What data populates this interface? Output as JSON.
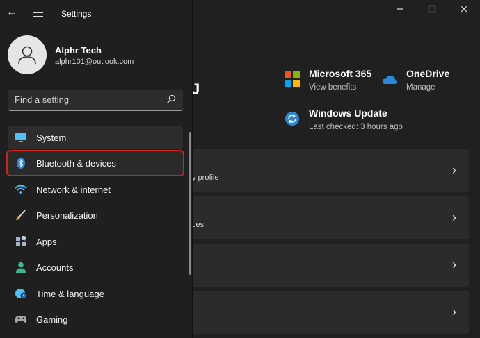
{
  "app": {
    "title": "Settings"
  },
  "user": {
    "name": "Alphr Tech",
    "email": "alphr101@outlook.com"
  },
  "search": {
    "placeholder": "Find a setting"
  },
  "nav": {
    "items": [
      {
        "label": "System",
        "icon": "monitor-icon",
        "color": "#4cc2ff"
      },
      {
        "label": "Bluetooth & devices",
        "icon": "bluetooth-icon",
        "color": "#2b88d8"
      },
      {
        "label": "Network & internet",
        "icon": "wifi-icon",
        "color": "#4cc2ff"
      },
      {
        "label": "Personalization",
        "icon": "brush-icon",
        "color": "#e8a33a"
      },
      {
        "label": "Apps",
        "icon": "apps-icon",
        "color": "#a8b4c8"
      },
      {
        "label": "Accounts",
        "icon": "person-icon",
        "color": "#3fb68b"
      },
      {
        "label": "Time & language",
        "icon": "globe-clock-icon",
        "color": "#4cc2ff"
      },
      {
        "label": "Gaming",
        "icon": "gamepad-icon",
        "color": "#a8a8a8"
      }
    ]
  },
  "header": {
    "partial_heading": "J"
  },
  "tiles": {
    "m365": {
      "title": "Microsoft 365",
      "sub": "View benefits"
    },
    "onedrive": {
      "title": "OneDrive",
      "sub": "Manage"
    },
    "update": {
      "title": "Windows Update",
      "sub": "Last checked: 3 hours ago"
    }
  },
  "cards": [
    {
      "sub": "y profile",
      "chevron": "›"
    },
    {
      "sub": "ces",
      "chevron": "›"
    },
    {
      "sub": "",
      "chevron": "›"
    },
    {
      "sub": "",
      "chevron": "›"
    }
  ],
  "accent": "#d42020"
}
